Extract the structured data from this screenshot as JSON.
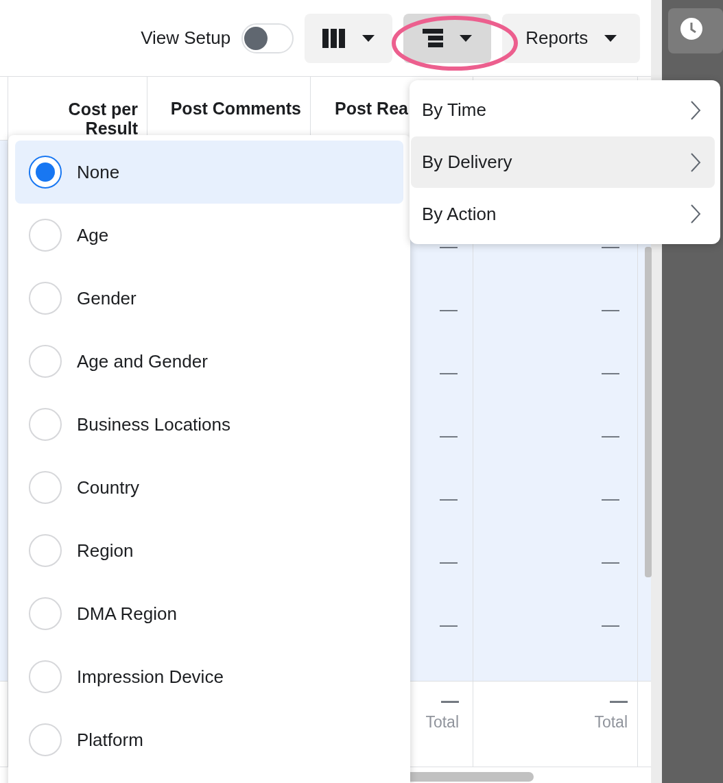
{
  "toolbar": {
    "view_setup": {
      "label": "View Setup",
      "on": false
    },
    "buttons": [
      {
        "kind": "columns",
        "selected": false
      },
      {
        "kind": "breakdown",
        "selected": true
      },
      {
        "kind": "reports",
        "label": "Reports",
        "selected": false
      }
    ]
  },
  "table": {
    "columns": [
      "Cost per Result",
      "Post Comments",
      "Post Rea"
    ],
    "rows": [
      [
        "—",
        "—"
      ],
      [
        "—",
        "—"
      ],
      [
        "—",
        "—"
      ],
      [
        "—",
        "—"
      ],
      [
        "—",
        "—"
      ],
      [
        "—",
        "—"
      ],
      [
        "—",
        "—"
      ]
    ],
    "totals": [
      {
        "value": "—",
        "label": "Total"
      },
      {
        "value": "—",
        "label": "Total"
      }
    ]
  },
  "breakdown_menu": [
    {
      "label": "By Time",
      "selected": false
    },
    {
      "label": "By Delivery",
      "selected": true
    },
    {
      "label": "By Action",
      "selected": false
    }
  ],
  "breakdown_options": [
    {
      "label": "None",
      "selected": true
    },
    {
      "label": "Age",
      "selected": false
    },
    {
      "label": "Gender",
      "selected": false
    },
    {
      "label": "Age and Gender",
      "selected": false
    },
    {
      "label": "Business Locations",
      "selected": false
    },
    {
      "label": "Country",
      "selected": false
    },
    {
      "label": "Region",
      "selected": false
    },
    {
      "label": "DMA Region",
      "selected": false
    },
    {
      "label": "Impression Device",
      "selected": false
    },
    {
      "label": "Platform",
      "selected": false
    }
  ]
}
